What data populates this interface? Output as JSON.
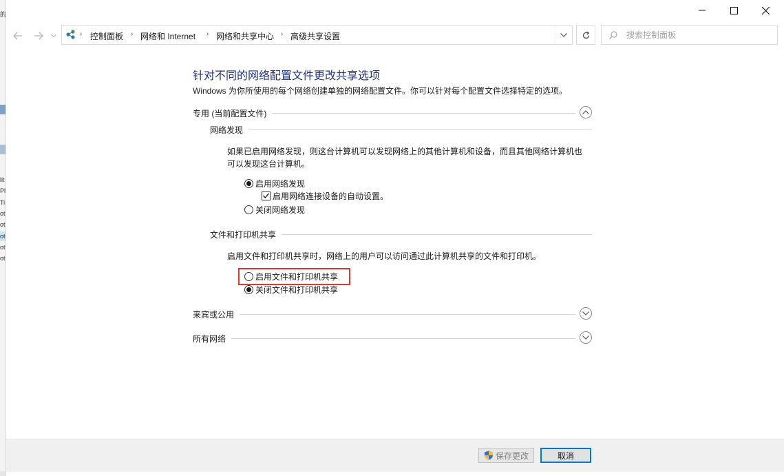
{
  "window": {
    "controls": {
      "minimize": "minimize-icon",
      "maximize": "maximize-icon",
      "close": "close-icon"
    }
  },
  "background_window": {
    "snippets": [
      "的",
      "lit",
      "Pl",
      "Ti",
      "ot",
      "ot",
      "ot",
      "ot",
      "ot"
    ]
  },
  "address": {
    "breadcrumbs": [
      "控制面板",
      "网络和 Internet",
      "网络和共享中心",
      "高级共享设置"
    ]
  },
  "search": {
    "placeholder": "搜索控制面板"
  },
  "page": {
    "title": "针对不同的网络配置文件更改共享选项",
    "subtitle": "Windows 为你所使用的每个网络创建单独的网络配置文件。你可以针对每个配置文件选择特定的选项。"
  },
  "profiles": {
    "private": {
      "label": "专用 (当前配置文件)",
      "expanded": true,
      "network_discovery": {
        "heading": "网络发现",
        "desc_line1": "如果已启用网络发现，则这台计算机可以发现网络上的其他计算机和设备，而且其他网络计算机也",
        "desc_line2": "可以发现这台计算机。",
        "option_on": "启用网络发现",
        "option_auto": "启用网络连接设备的自动设置。",
        "option_off": "关闭网络发现",
        "selected": "on",
        "auto_checked": true
      },
      "file_sharing": {
        "heading": "文件和打印机共享",
        "desc": "启用文件和打印机共享时，网络上的用户可以访问通过此计算机共享的文件和打印机。",
        "option_on": "启用文件和打印机共享",
        "option_off": "关闭文件和打印机共享",
        "selected": "off"
      }
    },
    "guest": {
      "label": "来宾或公用",
      "expanded": false
    },
    "all": {
      "label": "所有网络",
      "expanded": false
    }
  },
  "annotation": {
    "highlight_color": "#e8342f"
  },
  "buttons": {
    "save": "保存更改",
    "cancel": "取消"
  },
  "colors": {
    "title": "#1e3287",
    "accent": "#0078d7"
  }
}
